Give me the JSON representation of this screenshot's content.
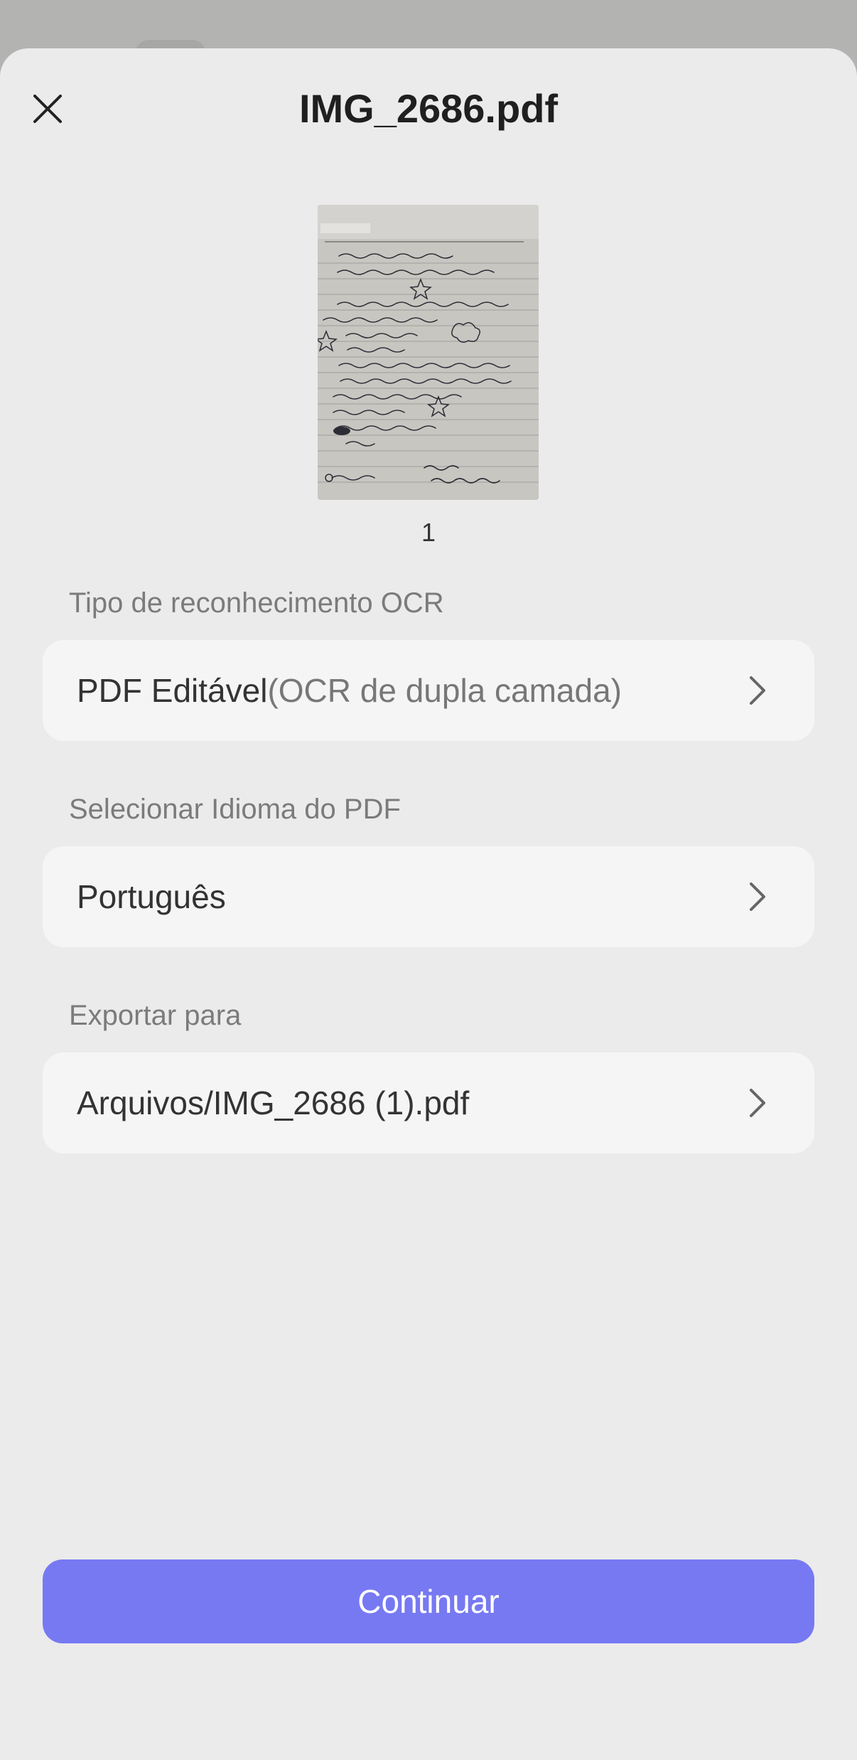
{
  "header": {
    "title": "IMG_2686.pdf",
    "close_icon": "close-icon"
  },
  "preview": {
    "page_number": "1"
  },
  "ocr_type": {
    "label": "Tipo de reconhecimento OCR",
    "value_primary": "PDF Editável",
    "value_secondary": "(OCR de dupla camada)"
  },
  "language": {
    "label": "Selecionar Idioma do PDF",
    "value": "Português"
  },
  "export": {
    "label": "Exportar para",
    "value": "Arquivos/IMG_2686 (1).pdf"
  },
  "actions": {
    "continue_label": "Continuar"
  },
  "colors": {
    "accent": "#7779f2",
    "sheet_background": "#ebebeb",
    "row_background": "#f5f5f5"
  }
}
